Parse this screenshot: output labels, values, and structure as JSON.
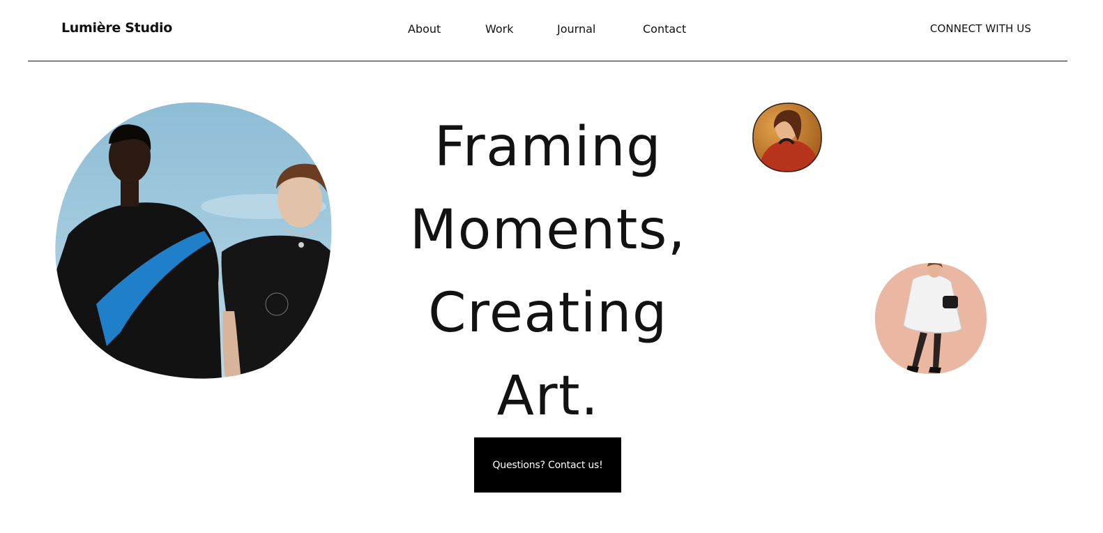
{
  "header": {
    "brand": "Lumière Studio",
    "nav": [
      {
        "label": "About"
      },
      {
        "label": "Work"
      },
      {
        "label": "Journal"
      },
      {
        "label": "Contact"
      }
    ],
    "cta_label": "CONNECT WITH US"
  },
  "hero": {
    "headline_lines": [
      "Framing",
      "Moments,",
      "Creating",
      "Art."
    ],
    "button_label": "Questions? Contact us!"
  },
  "images": {
    "main": "photo-two-models-sky",
    "small_top": "photo-woman-red-sweater",
    "small_right": "photo-woman-white-coat"
  },
  "colors": {
    "text": "#111111",
    "button_bg": "#000000",
    "button_text": "#ffffff",
    "sky": "#8fc0d8",
    "peach": "#e9b7a2",
    "amber": "#c77a2c"
  }
}
